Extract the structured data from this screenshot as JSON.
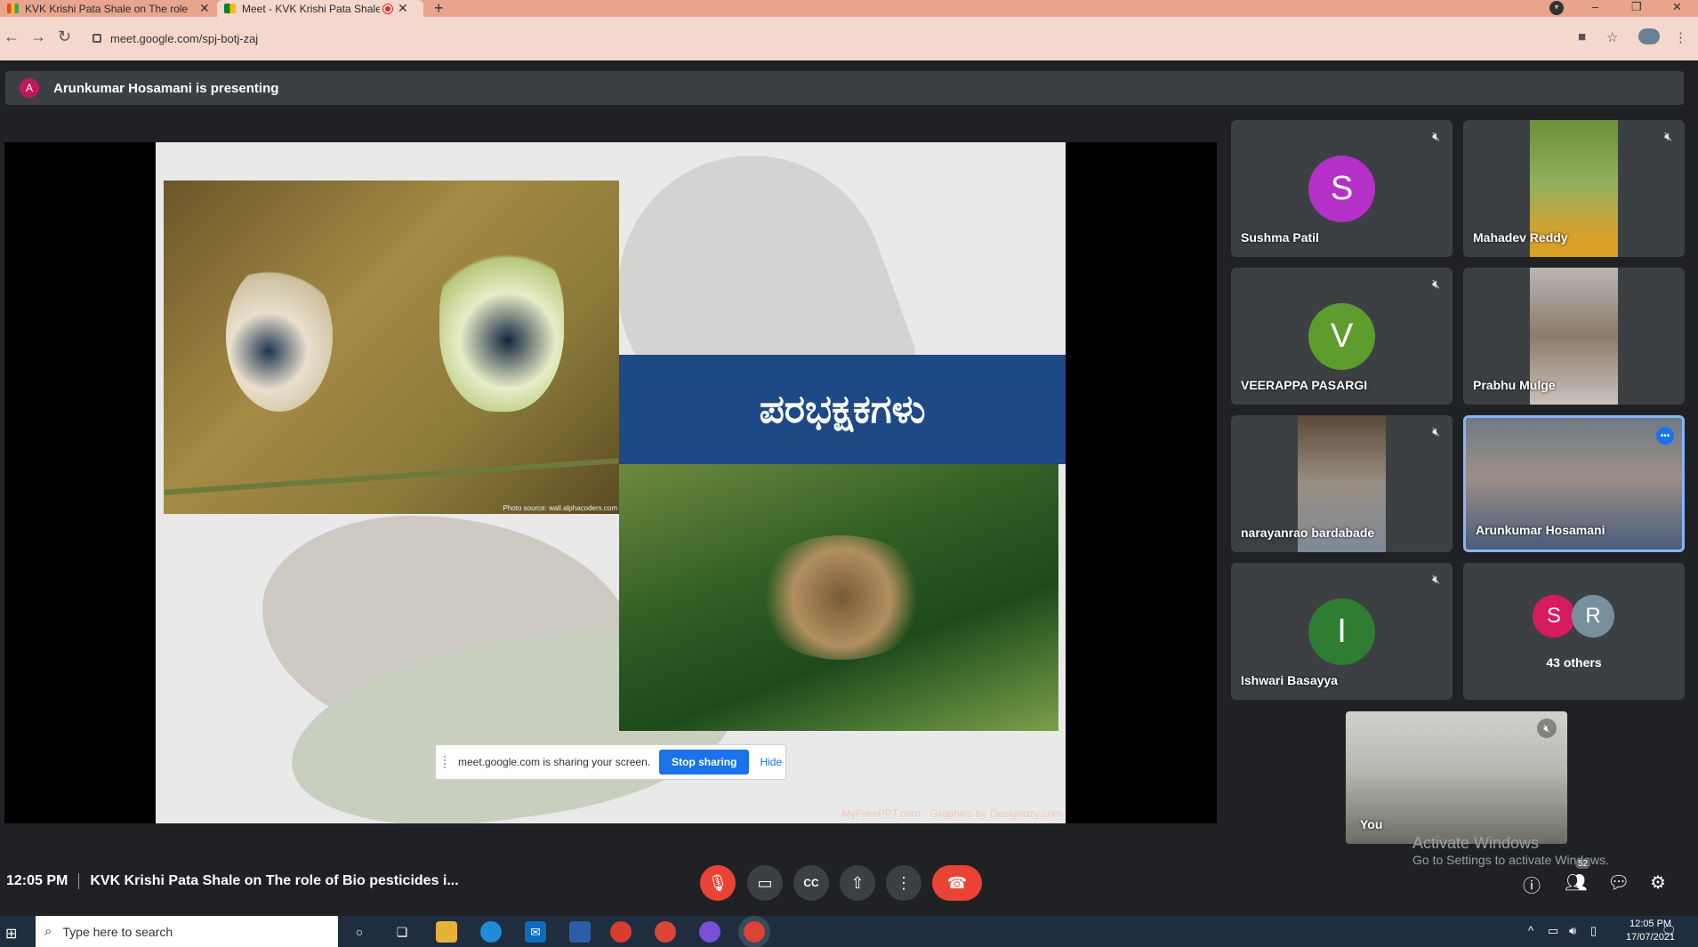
{
  "browser": {
    "tabs": [
      {
        "title": "KVK Krishi Pata Shale on The role",
        "favicon": "gmail-icon",
        "close": "✕"
      },
      {
        "title": "Meet - KVK Krishi Pata Shale",
        "favicon": "meet-icon",
        "close": "✕",
        "recording": true
      }
    ],
    "new_tab": "+",
    "url": "meet.google.com/spj-botj-zaj",
    "window_controls": [
      "–",
      "❐",
      "✕"
    ]
  },
  "presenting_banner": {
    "avatar_letter": "A",
    "text": "Arunkumar Hosamani is presenting"
  },
  "slide": {
    "title": "ಪರಭಕ್ಷಕಗಳು",
    "photo_source": "Photo source: wall.alphacoders.com",
    "credit": "MyFreePPT.com · Graphics by Designozy.com"
  },
  "share_bar": {
    "message": "meet.google.com is sharing your screen.",
    "stop_label": "Stop sharing",
    "hide_label": "Hide"
  },
  "participants": [
    {
      "name": "Sushma Patil",
      "letter": "S",
      "color": "#b530c9",
      "muted": true,
      "video": false
    },
    {
      "name": "Mahadev Reddy",
      "muted": true,
      "video": true
    },
    {
      "name": "VEERAPPA PASARGI",
      "letter": "V",
      "color": "#5e9c2d",
      "muted": true,
      "video": false
    },
    {
      "name": "Prabhu Mulge",
      "muted": false,
      "video": true
    },
    {
      "name": "narayanrao bardabade",
      "muted": true,
      "video": true
    },
    {
      "name": "Arunkumar Hosamani",
      "muted": false,
      "video": true,
      "speaking": true
    },
    {
      "name": "Ishwari Basayya",
      "letter": "I",
      "color": "#2e7d32",
      "muted": true,
      "video": false
    }
  ],
  "others": {
    "letters": [
      "S",
      "R"
    ],
    "colors": [
      "#d81b60",
      "#78909c"
    ],
    "label": "43 others"
  },
  "self_tile": {
    "name": "You"
  },
  "watermark": {
    "line1": "Activate Windows",
    "line2": "Go to Settings to activate Windows."
  },
  "meeting_info": {
    "time": "12:05 PM",
    "title": "KVK Krishi Pata Shale on The role of Bio pesticides i..."
  },
  "people_badge": "52",
  "taskbar": {
    "search_placeholder": "Type here to search",
    "time": "12:05 PM",
    "date": "17/07/2021"
  }
}
